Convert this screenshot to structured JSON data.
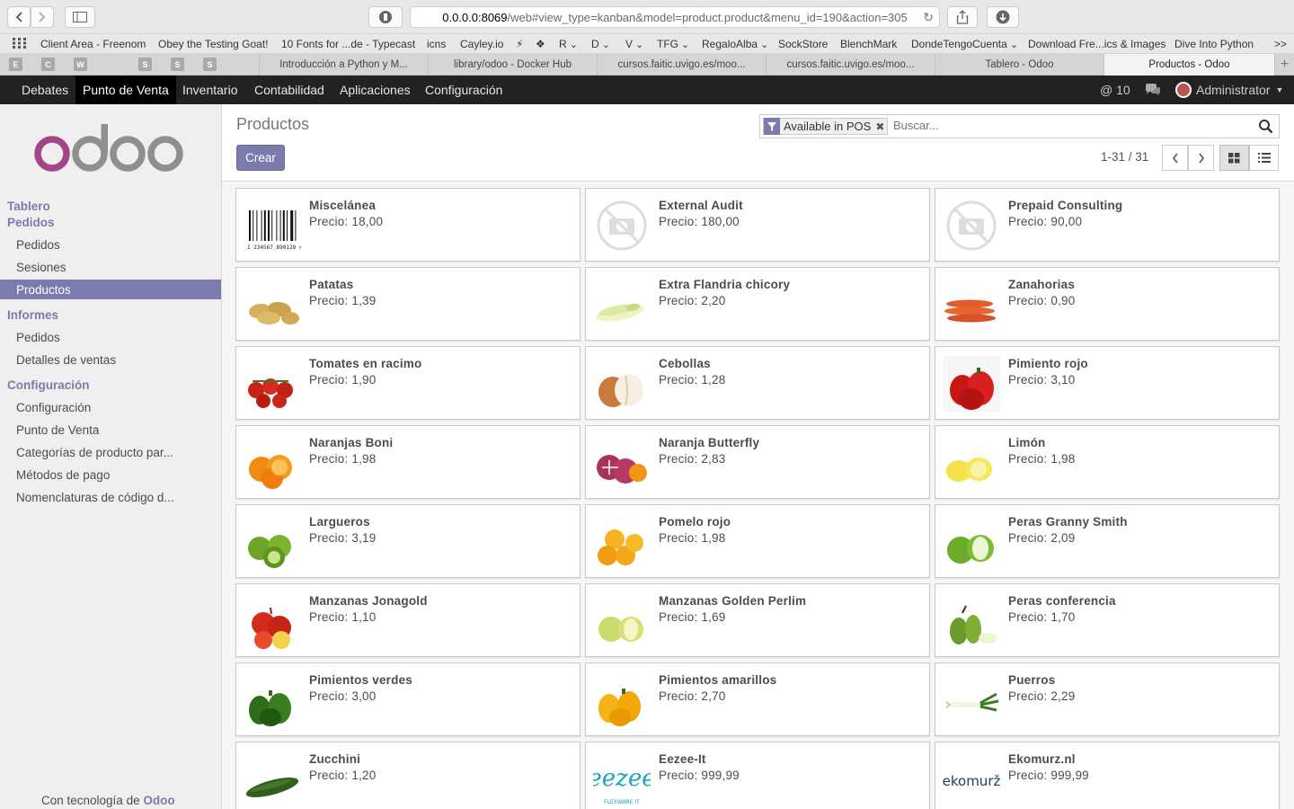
{
  "browser": {
    "url_host": "0.0.0.0:8069",
    "url_path": "/web#view_type=kanban&model=product.product&menu_id=190&action=305",
    "bookmarks": [
      {
        "label": "Client Area - Freenom",
        "menu": false
      },
      {
        "label": "Obey the Testing Goat!",
        "menu": false
      },
      {
        "label": "10 Fonts for ...de - Typecast",
        "menu": false
      },
      {
        "label": "icns",
        "menu": false
      },
      {
        "label": "Cayley.io",
        "menu": false
      },
      {
        "label": "⚡",
        "menu": false
      },
      {
        "label": "❖",
        "menu": false
      },
      {
        "label": "R",
        "menu": true
      },
      {
        "label": "D",
        "menu": true
      },
      {
        "label": "V",
        "menu": true
      },
      {
        "label": "TFG",
        "menu": true
      },
      {
        "label": "RegaloAlba",
        "menu": true
      },
      {
        "label": "SockStore",
        "menu": false
      },
      {
        "label": "BlenchMark",
        "menu": false
      },
      {
        "label": "DondeTengoCuenta",
        "menu": true
      },
      {
        "label": "Download Fre...ics & Images",
        "menu": false
      },
      {
        "label": "Dive Into Python",
        "menu": false
      }
    ],
    "bookmarks_overflow": ">>",
    "pinned_tabs": [
      "E",
      "C",
      "W",
      "",
      "S",
      "S",
      "S",
      ""
    ],
    "tabs": [
      {
        "label": "Introducción a Python y M...",
        "active": false
      },
      {
        "label": "library/odoo - Docker Hub",
        "active": false
      },
      {
        "label": "cursos.faitic.uvigo.es/moo...",
        "active": false
      },
      {
        "label": "cursos.faitic.uvigo.es/moo...",
        "active": false
      },
      {
        "label": "Tablero - Odoo",
        "active": false
      },
      {
        "label": "Productos - Odoo",
        "active": true
      }
    ]
  },
  "topbar": {
    "menu": [
      {
        "label": "Debates",
        "active": false
      },
      {
        "label": "Punto de Venta",
        "active": true
      },
      {
        "label": "Inventario",
        "active": false
      },
      {
        "label": "Contabilidad",
        "active": false
      },
      {
        "label": "Aplicaciones",
        "active": false
      },
      {
        "label": "Configuración",
        "active": false
      }
    ],
    "mentions": "@ 10",
    "user": "Administrator"
  },
  "sidebar": {
    "logo_text": "odoo",
    "sections": [
      {
        "heading": "Tablero",
        "items": []
      },
      {
        "heading": "Pedidos",
        "items": [
          {
            "label": "Pedidos",
            "active": false
          },
          {
            "label": "Sesiones",
            "active": false
          },
          {
            "label": "Productos",
            "active": true
          }
        ]
      },
      {
        "heading": "Informes",
        "items": [
          {
            "label": "Pedidos",
            "active": false
          },
          {
            "label": "Detalles de ventas",
            "active": false
          }
        ]
      },
      {
        "heading": "Configuración",
        "items": [
          {
            "label": "Configuración",
            "active": false
          },
          {
            "label": "Punto de Venta",
            "active": false
          },
          {
            "label": "Categorías de producto par...",
            "active": false
          },
          {
            "label": "Métodos de pago",
            "active": false
          },
          {
            "label": "Nomenclaturas de código d...",
            "active": false
          }
        ]
      }
    ],
    "powered_prefix": "Con tecnología de",
    "powered_brand": "Odoo"
  },
  "control_panel": {
    "title": "Productos",
    "create_label": "Crear",
    "facet_label": "Available in POS",
    "search_placeholder": "Buscar...",
    "pager": "1-31 / 31"
  },
  "colors": {
    "brand": "#7c7bad",
    "topbar": "#222222",
    "sidebar": "#f0eeee"
  },
  "products": [
    {
      "name": "Miscelánea",
      "price": "Precio: 18,00",
      "image": "barcode"
    },
    {
      "name": "External Audit",
      "price": "Precio: 180,00",
      "image": "no-photo"
    },
    {
      "name": "Prepaid Consulting",
      "price": "Precio: 90,00",
      "image": "no-photo"
    },
    {
      "name": "Patatas",
      "price": "Precio: 1,39",
      "image": "potato"
    },
    {
      "name": "Extra Flandria chicory",
      "price": "Precio: 2,20",
      "image": "chicory"
    },
    {
      "name": "Zanahorias",
      "price": "Precio: 0,90",
      "image": "carrot"
    },
    {
      "name": "Tomates en racimo",
      "price": "Precio: 1,90",
      "image": "tomato"
    },
    {
      "name": "Cebollas",
      "price": "Precio: 1,28",
      "image": "onion"
    },
    {
      "name": "Pimiento rojo",
      "price": "Precio: 3,10",
      "image": "red-pepper"
    },
    {
      "name": "Naranjas Boni",
      "price": "Precio: 1,98",
      "image": "orange"
    },
    {
      "name": "Naranja Butterfly",
      "price": "Precio: 2,83",
      "image": "butterfly-orange"
    },
    {
      "name": "Limón",
      "price": "Precio: 1,98",
      "image": "lemon"
    },
    {
      "name": "Largueros",
      "price": "Precio: 3,19",
      "image": "lime"
    },
    {
      "name": "Pomelo rojo",
      "price": "Precio: 1,98",
      "image": "grapefruit"
    },
    {
      "name": "Peras Granny Smith",
      "price": "Precio: 2,09",
      "image": "green-apple"
    },
    {
      "name": "Manzanas Jonagold",
      "price": "Precio: 1,10",
      "image": "red-apple"
    },
    {
      "name": "Manzanas Golden Perlim",
      "price": "Precio: 1,69",
      "image": "golden-apple"
    },
    {
      "name": "Peras conferencia",
      "price": "Precio: 1,70",
      "image": "pear"
    },
    {
      "name": "Pimientos verdes",
      "price": "Precio: 3,00",
      "image": "green-pepper"
    },
    {
      "name": "Pimientos amarillos",
      "price": "Precio: 2,70",
      "image": "yellow-pepper"
    },
    {
      "name": "Puerros",
      "price": "Precio: 2,29",
      "image": "leek"
    },
    {
      "name": "Zucchini",
      "price": "Precio: 1,20",
      "image": "zucchini"
    },
    {
      "name": "Eezee-It",
      "price": "Precio: 999,99",
      "image": "eezee-logo",
      "image_text": "eezee",
      "image_subtext": "FLEXWARE IT"
    },
    {
      "name": "Ekomurz.nl",
      "price": "Precio: 999,99",
      "image": "ekomurz-logo",
      "image_text": "ekomurž"
    }
  ]
}
